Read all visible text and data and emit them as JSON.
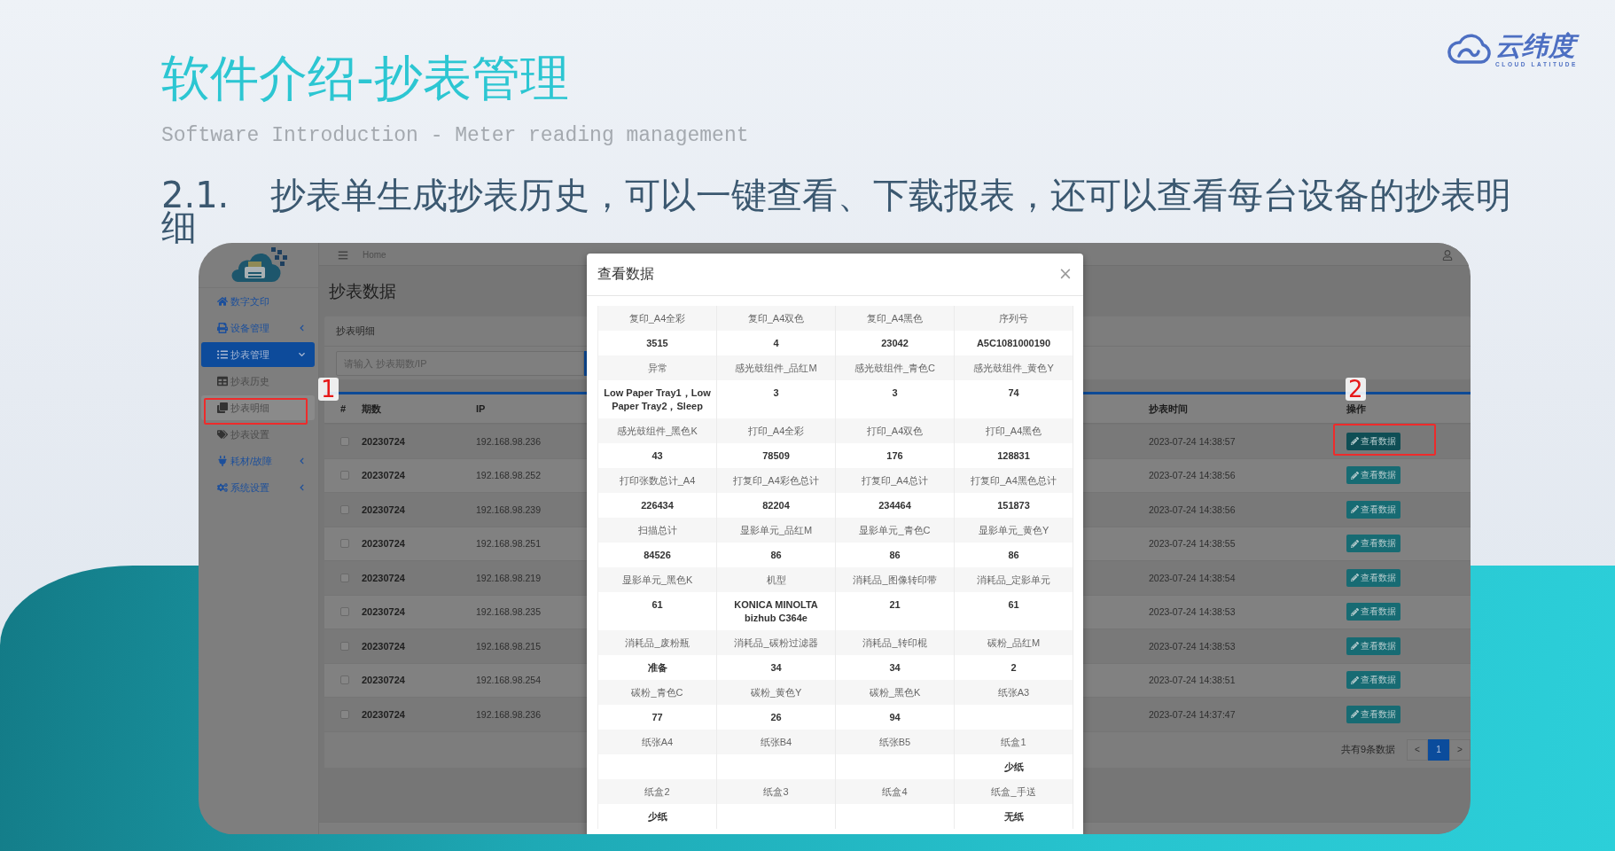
{
  "slide": {
    "title": "软件介绍-抄表管理",
    "subtitle": "Software Introduction - Meter reading management",
    "point": {
      "number": "2.1.",
      "text": "抄表单生成抄表历史，可以一键查看、下载报表，还可以查看每台设备的抄表明细"
    }
  },
  "logo": {
    "name": "云纬度",
    "tagline": "CLOUD LATITUDE"
  },
  "app": {
    "topbar": {
      "breadcrumb": "Home"
    },
    "sidebar": {
      "items": [
        {
          "kind": "link",
          "label": "数字文印",
          "selected": false
        },
        {
          "kind": "group",
          "label": "设备管理",
          "selected": false,
          "expanded": false
        },
        {
          "kind": "group",
          "label": "抄表管理",
          "selected": true,
          "expanded": true,
          "children": [
            {
              "label": "抄表历史",
              "selected": false
            },
            {
              "label": "抄表明细",
              "selected": true
            },
            {
              "label": "抄表设置",
              "selected": false
            }
          ]
        },
        {
          "kind": "group",
          "label": "耗材/故障",
          "selected": false,
          "expanded": false
        },
        {
          "kind": "group",
          "label": "系统设置",
          "selected": false,
          "expanded": false
        }
      ]
    },
    "page_title": "抄表数据",
    "search_panel": {
      "title": "抄表明细",
      "search": {
        "placeholder": "请输入 抄表期数/IP"
      }
    },
    "table": {
      "columns": [
        "#",
        "期数",
        "IP",
        "抄表时间",
        "操作"
      ],
      "rows": [
        {
          "checked": false,
          "period": "20230724",
          "ip": "192.168.98.236",
          "time": "2023-07-24 14:38:57",
          "action": "查看数据",
          "active": true
        },
        {
          "checked": false,
          "period": "20230724",
          "ip": "192.168.98.252",
          "time": "2023-07-24 14:38:56",
          "action": "查看数据",
          "active": false
        },
        {
          "checked": false,
          "period": "20230724",
          "ip": "192.168.98.239",
          "time": "2023-07-24 14:38:56",
          "action": "查看数据",
          "active": false
        },
        {
          "checked": false,
          "period": "20230724",
          "ip": "192.168.98.251",
          "time": "2023-07-24 14:38:55",
          "action": "查看数据",
          "active": false
        },
        {
          "checked": false,
          "period": "20230724",
          "ip": "192.168.98.219",
          "time": "2023-07-24 14:38:54",
          "action": "查看数据",
          "active": false
        },
        {
          "checked": false,
          "period": "20230724",
          "ip": "192.168.98.235",
          "time": "2023-07-24 14:38:53",
          "action": "查看数据",
          "active": false
        },
        {
          "checked": false,
          "period": "20230724",
          "ip": "192.168.98.215",
          "time": "2023-07-24 14:38:53",
          "action": "查看数据",
          "active": false
        },
        {
          "checked": false,
          "period": "20230724",
          "ip": "192.168.98.254",
          "time": "2023-07-24 14:38:51",
          "action": "查看数据",
          "active": false
        },
        {
          "checked": false,
          "period": "20230724",
          "ip": "192.168.98.236",
          "time": "2023-07-24 14:37:47",
          "action": "查看数据",
          "active": false
        }
      ]
    },
    "pagination": {
      "summary": "共有9条数据",
      "prev": "<",
      "pages": [
        {
          "label": "1",
          "selected": true
        }
      ],
      "next": ">"
    }
  },
  "modal": {
    "title": "查看数据",
    "close": "×",
    "fields": [
      {
        "label": "复印_A4全彩",
        "value": "3515"
      },
      {
        "label": "复印_A4双色",
        "value": "4"
      },
      {
        "label": "复印_A4黑色",
        "value": "23042"
      },
      {
        "label": "序列号",
        "value": "A5C1081000190"
      },
      {
        "label": "异常",
        "value": "Low Paper Tray1，Low Paper Tray2，Sleep"
      },
      {
        "label": "感光鼓组件_品红M",
        "value": "3"
      },
      {
        "label": "感光鼓组件_青色C",
        "value": "3"
      },
      {
        "label": "感光鼓组件_黄色Y",
        "value": "74"
      },
      {
        "label": "感光鼓组件_黑色K",
        "value": "43"
      },
      {
        "label": "打印_A4全彩",
        "value": "78509"
      },
      {
        "label": "打印_A4双色",
        "value": "176"
      },
      {
        "label": "打印_A4黑色",
        "value": "128831"
      },
      {
        "label": "打印张数总计_A4",
        "value": "226434"
      },
      {
        "label": "打复印_A4彩色总计",
        "value": "82204"
      },
      {
        "label": "打复印_A4总计",
        "value": "234464"
      },
      {
        "label": "打复印_A4黑色总计",
        "value": "151873"
      },
      {
        "label": "扫描总计",
        "value": "84526"
      },
      {
        "label": "显影单元_品红M",
        "value": "86"
      },
      {
        "label": "显影单元_青色C",
        "value": "86"
      },
      {
        "label": "显影单元_黄色Y",
        "value": "86"
      },
      {
        "label": "显影单元_黑色K",
        "value": "61"
      },
      {
        "label": "机型",
        "value": "KONICA MINOLTA bizhub C364e"
      },
      {
        "label": "消耗品_图像转印带",
        "value": "21"
      },
      {
        "label": "消耗品_定影单元",
        "value": "61"
      },
      {
        "label": "消耗品_废粉瓶",
        "value": "准备"
      },
      {
        "label": "消耗品_碳粉过滤器",
        "value": "34"
      },
      {
        "label": "消耗品_转印棍",
        "value": "34"
      },
      {
        "label": "碳粉_品红M",
        "value": "2"
      },
      {
        "label": "碳粉_青色C",
        "value": "77"
      },
      {
        "label": "碳粉_黄色Y",
        "value": "26"
      },
      {
        "label": "碳粉_黑色K",
        "value": "94"
      },
      {
        "label": "纸张A3"
      },
      {
        "label": "纸张A4"
      },
      {
        "label": "纸张B4"
      },
      {
        "label": "纸张B5"
      },
      {
        "label": "纸盒1",
        "value": "少纸"
      },
      {
        "label": "纸盒2",
        "value": "少纸"
      },
      {
        "label": "纸盒3"
      },
      {
        "label": "纸盒4"
      },
      {
        "label": "纸盒_手送",
        "value": "无纸"
      }
    ]
  },
  "annotations": [
    {
      "label": "1"
    },
    {
      "label": "2"
    }
  ]
}
